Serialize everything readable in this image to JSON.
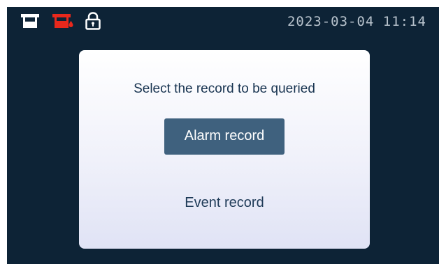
{
  "status_bar": {
    "icons": [
      "tank-icon",
      "tank-alarm-icon",
      "lock-icon"
    ],
    "datetime": "2023-03-04  11:14"
  },
  "dialog": {
    "title": "Select the record to be queried",
    "alarm_button_label": "Alarm record",
    "event_button_label": "Event record"
  },
  "colors": {
    "screen_background": "#0d2336",
    "alarm_icon": "#e8281c",
    "selected_button": "#3f617e"
  }
}
